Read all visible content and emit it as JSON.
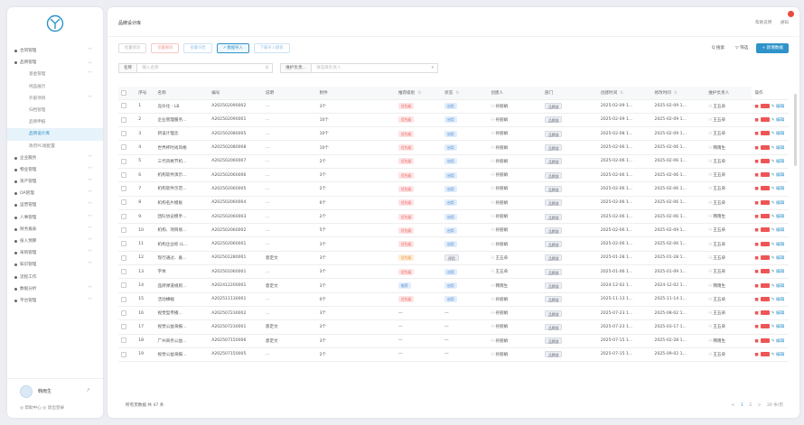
{
  "header": {
    "title": "品牌设计库",
    "help": "帮助说明",
    "notice": "通知"
  },
  "sidebar": {
    "items": [
      {
        "label": "合同管理",
        "level": 1,
        "arrow": "﹀"
      },
      {
        "label": "品牌管理",
        "level": 1,
        "arrow": "︿"
      },
      {
        "label": "基金管理",
        "level": 2,
        "arrow": "﹀"
      },
      {
        "label": "纯品展示",
        "level": 2,
        "arrow": ""
      },
      {
        "label": "外部项目",
        "level": 2,
        "arrow": "﹀"
      },
      {
        "label": "归档管理",
        "level": 2,
        "arrow": ""
      },
      {
        "label": "品牌申报",
        "level": 2,
        "arrow": ""
      },
      {
        "label": "品牌设计库",
        "level": 2,
        "arrow": "",
        "active": true
      },
      {
        "label": "政府PC端配置",
        "level": 2,
        "arrow": ""
      },
      {
        "label": "企业服务",
        "level": 1,
        "arrow": "﹀"
      },
      {
        "label": "物业管理",
        "level": 1,
        "arrow": "﹀"
      },
      {
        "label": "资产管理",
        "level": 1,
        "arrow": "﹀"
      },
      {
        "label": "OA管理",
        "level": 1,
        "arrow": "﹀"
      },
      {
        "label": "运营管理",
        "level": 1,
        "arrow": "﹀"
      },
      {
        "label": "人事管理",
        "level": 1,
        "arrow": "﹀"
      },
      {
        "label": "财务报表",
        "level": 1,
        "arrow": "﹀"
      },
      {
        "label": "投入预算",
        "level": 1,
        "arrow": "﹀"
      },
      {
        "label": "采购管理",
        "level": 1,
        "arrow": "﹀"
      },
      {
        "label": "知识管理",
        "level": 1,
        "arrow": "﹀"
      },
      {
        "label": "流程工作",
        "level": 1,
        "arrow": ""
      },
      {
        "label": "数据分析",
        "level": 1,
        "arrow": "﹀"
      },
      {
        "label": "平台管理",
        "level": 1,
        "arrow": "﹀"
      }
    ],
    "user_name": "韩雨生",
    "expand": "↗",
    "links": "◎ 帮助中心   ◎ 退出登录"
  },
  "toolbar": {
    "buttons": [
      {
        "label": "批量修改",
        "style": ""
      },
      {
        "label": "批量删除",
        "style": "red"
      },
      {
        "label": "批量归档",
        "style": "blue"
      },
      {
        "label": "↗ 数据导入",
        "style": "active"
      },
      {
        "label": "下载导入模板",
        "style": "blue"
      }
    ],
    "search_label": "Q 搜索",
    "filter_label": "▽ 筛选",
    "add_label": "+ 新增数据"
  },
  "filters": {
    "name_label": "名称",
    "name_placeholder": "输入名称",
    "name_suffix": "Q",
    "maint_label": "维护负责...",
    "maint_placeholder": "请选择负责人",
    "maint_suffix": "▾"
  },
  "table": {
    "columns": [
      "",
      "序号",
      "名称",
      "编号",
      "说明",
      "附件",
      "推荐级别",
      "状态",
      "创建人",
      "部门",
      "创建时间",
      "修改时间",
      "维护负责人",
      "操作"
    ],
    "sortable": [
      false,
      false,
      false,
      false,
      false,
      false,
      true,
      true,
      false,
      false,
      true,
      true,
      false,
      false
    ],
    "rows": [
      {
        "no": "1",
        "name": "竞价化 - LB",
        "code": "A202502090002",
        "desc": "...",
        "attach": "3个",
        "level": "优先级",
        "level_color": "red",
        "status": "启用",
        "status_color": "blue",
        "creator": "孙丽娟",
        "dept": "品牌部",
        "created": "2025-02-09 1...",
        "modified": "2025-02-09 1...",
        "owner": "王五朵"
      },
      {
        "no": "2",
        "name": "企业管理服务...",
        "code": "A202502090001",
        "desc": "...",
        "attach": "10个",
        "level": "优先级",
        "level_color": "red",
        "status": "启用",
        "status_color": "blue",
        "creator": "孙丽娟",
        "dept": "品牌部",
        "created": "2025-02-09 1...",
        "modified": "2025-02-09 1...",
        "owner": "王五朵"
      },
      {
        "no": "3",
        "name": "新设计理念",
        "code": "A202502080005",
        "desc": "...",
        "attach": "10个",
        "level": "优先级",
        "level_color": "red",
        "status": "启用",
        "status_color": "blue",
        "creator": "孙丽娟",
        "dept": "品牌部",
        "created": "2025-02-08 1...",
        "modified": "2025-02-09 1...",
        "owner": "王五朵"
      },
      {
        "no": "4",
        "name": "世界杯时尚风格",
        "code": "A202502080008",
        "desc": "...",
        "attach": "10个",
        "level": "优先级",
        "level_color": "red",
        "status": "启用",
        "status_color": "blue",
        "creator": "孙丽娟",
        "dept": "品牌部",
        "created": "2025-02-06 1...",
        "modified": "2025-02-06 1...",
        "owner": "韩雨生"
      },
      {
        "no": "5",
        "name": "三代风格节机...",
        "code": "A202502060007",
        "desc": "...",
        "attach": "2个",
        "level": "优先级",
        "level_color": "red",
        "status": "启用",
        "status_color": "blue",
        "creator": "孙丽娟",
        "dept": "品牌部",
        "created": "2025-02-06 1...",
        "modified": "2025-02-06 1...",
        "owner": "王五朵"
      },
      {
        "no": "6",
        "name": "机构软件演示...",
        "code": "A202502060006",
        "desc": "...",
        "attach": "3个",
        "level": "优先级",
        "level_color": "red",
        "status": "启用",
        "status_color": "blue",
        "creator": "孙丽娟",
        "dept": "品牌部",
        "created": "2025-02-06 1...",
        "modified": "2025-02-06 1...",
        "owner": "王五朵"
      },
      {
        "no": "7",
        "name": "机构软件示范...",
        "code": "A202502060005",
        "desc": "...",
        "attach": "2个",
        "level": "优先级",
        "level_color": "red",
        "status": "启用",
        "status_color": "blue",
        "creator": "孙丽娟",
        "dept": "品牌部",
        "created": "2025-02-06 1...",
        "modified": "2025-02-06 1...",
        "owner": "王五朵"
      },
      {
        "no": "8",
        "name": "机构名片模板",
        "code": "A202502060004",
        "desc": "...",
        "attach": "6个",
        "level": "优先级",
        "level_color": "red",
        "status": "启用",
        "status_color": "blue",
        "creator": "孙丽娟",
        "dept": "品牌部",
        "created": "2025-02-06 1...",
        "modified": "2025-02-06 1...",
        "owner": "王五朵"
      },
      {
        "no": "9",
        "name": "团队协议模手...",
        "code": "A202502060003",
        "desc": "...",
        "attach": "2个",
        "level": "优先级",
        "level_color": "red",
        "status": "启用",
        "status_color": "blue",
        "creator": "孙丽娟",
        "dept": "品牌部",
        "created": "2025-02-06 1...",
        "modified": "2025-02-06 1...",
        "owner": "韩雨生"
      },
      {
        "no": "10",
        "name": "机构、项目易...",
        "code": "A202502060002",
        "desc": "...",
        "attach": "5个",
        "level": "优先级",
        "level_color": "red",
        "status": "启用",
        "status_color": "blue",
        "creator": "孙丽娟",
        "dept": "品牌部",
        "created": "2025-02-06 1...",
        "modified": "2025-02-09 1...",
        "owner": "王五朵"
      },
      {
        "no": "11",
        "name": "机构企业标 (L...",
        "code": "A202502060001",
        "desc": "...",
        "attach": "3个",
        "level": "优先级",
        "level_color": "red",
        "status": "启用",
        "status_color": "blue",
        "creator": "孙丽娟",
        "dept": "品牌部",
        "created": "2025-02-06 1...",
        "modified": "2025-02-06 1...",
        "owner": "王五朵"
      },
      {
        "no": "12",
        "name": "现行通过、备...",
        "code": "A202501280001",
        "desc": "意定文",
        "attach": "3个",
        "level": "优先级",
        "level_color": "orange",
        "status": "停用",
        "status_color": "gray",
        "creator": "王五朵",
        "dept": "品牌部",
        "created": "2025-01-28 1...",
        "modified": "2025-01-28 1...",
        "owner": "王五朵"
      },
      {
        "no": "13",
        "name": "字体",
        "code": "A202501060001",
        "desc": "...",
        "attach": "3个",
        "level": "优先级",
        "level_color": "red",
        "status": "启用",
        "status_color": "blue",
        "creator": "王五朵",
        "dept": "品牌部",
        "created": "2025-01-06 1...",
        "modified": "2025-01-09 1...",
        "owner": "王五朵"
      },
      {
        "no": "14",
        "name": "品牌弹道规则...",
        "code": "A202412200001",
        "desc": "意定文",
        "attach": "3个",
        "level": "推荐",
        "level_color": "blue",
        "status": "启用",
        "status_color": "blue",
        "creator": "韩雨生",
        "dept": "品牌部",
        "created": "2024-12-02 1...",
        "modified": "2024-12-02 1...",
        "owner": "韩雨生"
      },
      {
        "no": "15",
        "name": "活动横幅",
        "code": "A202511130001",
        "desc": "...",
        "attach": "0个",
        "level": "优先级",
        "level_color": "red",
        "status": "启用",
        "status_color": "blue",
        "creator": "孙丽娟",
        "dept": "品牌部",
        "created": "2025-11-13 1...",
        "modified": "2025-11-14 1...",
        "owner": "王五朵"
      },
      {
        "no": "16",
        "name": "视觉型传播...",
        "code": "A202507230002",
        "desc": "...",
        "attach": "3个",
        "level": "—",
        "level_color": "none",
        "status": "—",
        "status_color": "none",
        "creator": "孙丽娟",
        "dept": "品牌部",
        "created": "2025-07-23 1...",
        "modified": "2025-08-02 1...",
        "owner": "王五朵"
      },
      {
        "no": "17",
        "name": "视觉公益海报...",
        "code": "A202507230001",
        "desc": "意定文",
        "attach": "3个",
        "level": "—",
        "level_color": "none",
        "status": "—",
        "status_color": "none",
        "creator": "孙丽娟",
        "dept": "品牌部",
        "created": "2025-07-23 1...",
        "modified": "2025-03-17 1...",
        "owner": "王五朵"
      },
      {
        "no": "18",
        "name": "广州商务公益...",
        "code": "A202507150006",
        "desc": "意定文",
        "attach": "3个",
        "level": "—",
        "level_color": "none",
        "status": "—",
        "status_color": "none",
        "creator": "孙丽娟",
        "dept": "品牌部",
        "created": "2025-07-15 1...",
        "modified": "2025-02-28 1...",
        "owner": "韩雨生"
      },
      {
        "no": "19",
        "name": "视觉公益海报...",
        "code": "A202507150005",
        "desc": "...",
        "attach": "2个",
        "level": "—",
        "level_color": "none",
        "status": "—",
        "status_color": "none",
        "creator": "孙丽娟",
        "dept": "品牌部",
        "created": "2025-07-15 1...",
        "modified": "2025-09-02 1...",
        "owner": "王五朵"
      }
    ],
    "op_edit": "编辑"
  },
  "footer": {
    "total": "所有页数据  共 47 条",
    "prev": "<",
    "page1": "1",
    "page2": "2",
    "next": ">",
    "page_size": "20 条/页"
  },
  "colors": {
    "accent": "#2f93c9",
    "danger": "#e55555"
  }
}
